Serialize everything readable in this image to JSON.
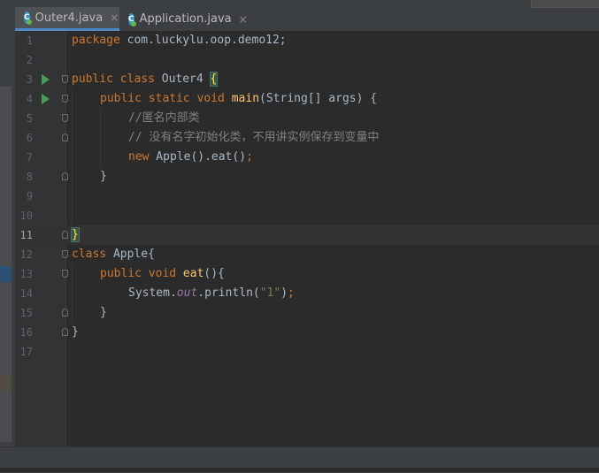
{
  "tabs": [
    {
      "label": "Outer4.java",
      "active": true,
      "icon": "java-class-icon"
    },
    {
      "label": "Application.java",
      "active": false,
      "icon": "java-class-icon"
    }
  ],
  "icons": {
    "close": "×",
    "class_letter": "C"
  },
  "editor": {
    "current_line": 11,
    "lines": [
      {
        "n": "1"
      },
      {
        "n": "2"
      },
      {
        "n": "3"
      },
      {
        "n": "4"
      },
      {
        "n": "5"
      },
      {
        "n": "6"
      },
      {
        "n": "7"
      },
      {
        "n": "8"
      },
      {
        "n": "9"
      },
      {
        "n": "10"
      },
      {
        "n": "11"
      },
      {
        "n": "12"
      },
      {
        "n": "13"
      },
      {
        "n": "14"
      },
      {
        "n": "15"
      },
      {
        "n": "16"
      },
      {
        "n": "17"
      }
    ],
    "code": {
      "l1_kw": "package",
      "l1_rest": " com.luckylu.oop.demo12;",
      "l3_kw": "public class",
      "l3_name": " Outer4 ",
      "l3_brace": "{",
      "l4_kw": "public static void",
      "l4_fn": " main",
      "l4_rest": "(String[] args) {",
      "l5_cm": "//匿名内部类",
      "l6_cm": "// 没有名字初始化类，不用讲实例保存到变量中",
      "l7_kw": "new",
      "l7_rest": " Apple().eat()",
      "l7_semi": ";",
      "l8": "}",
      "l11_brace": "}",
      "l12_kw": "class",
      "l12_rest": " Apple{",
      "l13_kw": "public void",
      "l13_fn": " eat",
      "l13_rest": "(){",
      "l14_a": "System.",
      "l14_out": "out",
      "l14_b": ".println(",
      "l14_str": "\"1\"",
      "l14_c": ")",
      "l14_semi": ";",
      "l15": "}",
      "l16": "}"
    }
  },
  "colors": {
    "keyword": "#cc7832",
    "function": "#ffc66d",
    "comment": "#808080",
    "string": "#6a8759",
    "run": "#499c54"
  }
}
